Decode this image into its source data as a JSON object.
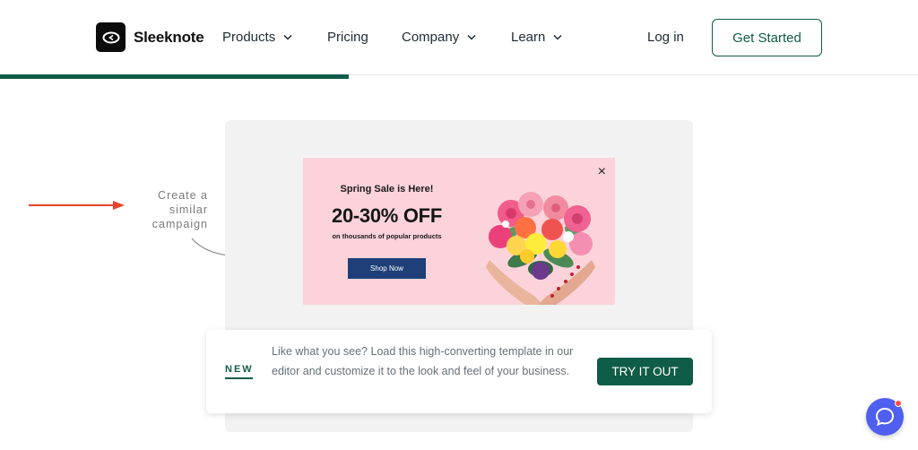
{
  "brand": {
    "name": "Sleeknote",
    "accent": "#0f5c48"
  },
  "nav": {
    "items": [
      {
        "label": "Products",
        "has_dropdown": true
      },
      {
        "label": "Pricing",
        "has_dropdown": false
      },
      {
        "label": "Company",
        "has_dropdown": true
      },
      {
        "label": "Learn",
        "has_dropdown": true
      }
    ],
    "login": "Log in",
    "cta": "Get Started"
  },
  "scroll_progress_percent": 38,
  "annotation": {
    "hint_lines": [
      "Create a",
      "similar",
      "campaign"
    ],
    "arrow_color": "#e8412c"
  },
  "popup": {
    "background": "#fcd3da",
    "eyebrow": "Spring Sale is Here!",
    "headline": "20-30% OFF",
    "subline": "on thousands of popular products",
    "button": "Shop Now",
    "close_symbol": "×",
    "image": "hands-holding-flowers-heart"
  },
  "cta_bar": {
    "tag": "NEW",
    "text": "Like what you see? Load this high-converting template in our editor and customize it to the look and feel of your business.",
    "button": "TRY IT OUT"
  },
  "chat": {
    "icon": "chat-bubble-icon",
    "notification": true,
    "color": "#4f5ff0"
  }
}
